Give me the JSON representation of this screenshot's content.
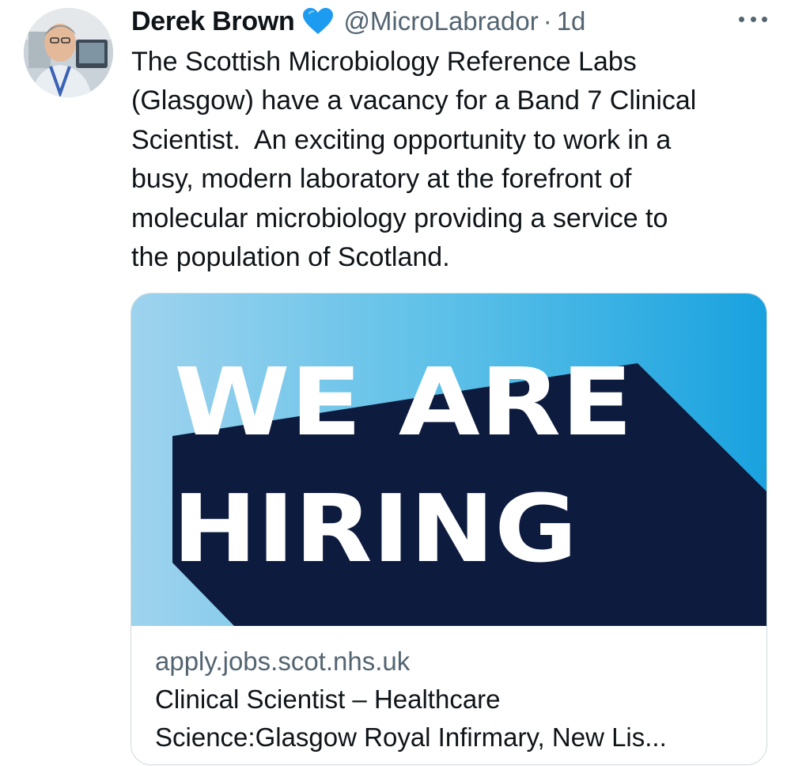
{
  "tweet": {
    "display_name": "Derek Brown",
    "verified_icon": "blue-heart-icon",
    "handle": "@MicroLabrador",
    "separator": "·",
    "time": "1d",
    "more_icon": "more-dots-icon",
    "lines": [
      "The Scottish Microbiology Reference Labs",
      "(Glasgow) have a vacancy for a Band 7 Clinical",
      "Scientist.  An exciting opportunity to work in a",
      "busy, modern laboratory at the forefront of",
      "molecular microbiology providing a service to",
      "the population of Scotland."
    ]
  },
  "card": {
    "image_text_line1": "WE ARE",
    "image_text_line2": "HIRING",
    "domain": "apply.jobs.scot.nhs.uk",
    "title_line1": "Clinical Scientist – Healthcare",
    "title_line2": "Science:Glasgow Royal Infirmary, New Lis..."
  },
  "colors": {
    "heart": "#1d9bf0",
    "image_sky": "#5cc0e8",
    "image_shadow": "#0d1b3e",
    "text_white": "#ffffff"
  }
}
